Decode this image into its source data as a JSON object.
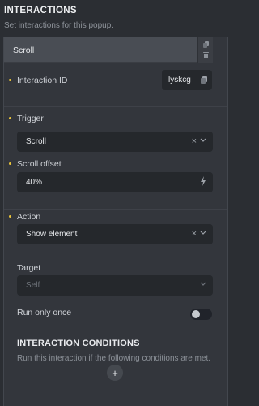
{
  "header": {
    "title": "INTERACTIONS",
    "subtitle": "Set interactions for this popup."
  },
  "interaction_tab": {
    "label": "Scroll",
    "icons": [
      "copy-icon",
      "delete-icon"
    ]
  },
  "fields": {
    "interaction_id": {
      "label": "Interaction ID",
      "value": "lyskcg",
      "icon": "copy-icon"
    },
    "trigger": {
      "label": "Trigger",
      "value": "Scroll",
      "clear_icon": "close-icon",
      "dropdown_icon": "chevron-down-icon"
    },
    "scroll_offset": {
      "label": "Scroll offset",
      "value": "40%",
      "icon": "lightning-icon"
    },
    "action": {
      "label": "Action",
      "value": "Show element",
      "clear_icon": "close-icon",
      "dropdown_icon": "chevron-down-icon"
    },
    "target": {
      "label": "Target",
      "placeholder": "Self",
      "dropdown_icon": "chevron-down-icon"
    },
    "run_only_once": {
      "label": "Run only once",
      "checked": false
    }
  },
  "conditions": {
    "title": "INTERACTION CONDITIONS",
    "description": "Run this interaction if the following conditions are met.",
    "add_label": "+"
  },
  "colors": {
    "background": "#2b2e33",
    "panel": "#33363c",
    "input": "#25282c",
    "accent_dot": "#e9c33a"
  }
}
